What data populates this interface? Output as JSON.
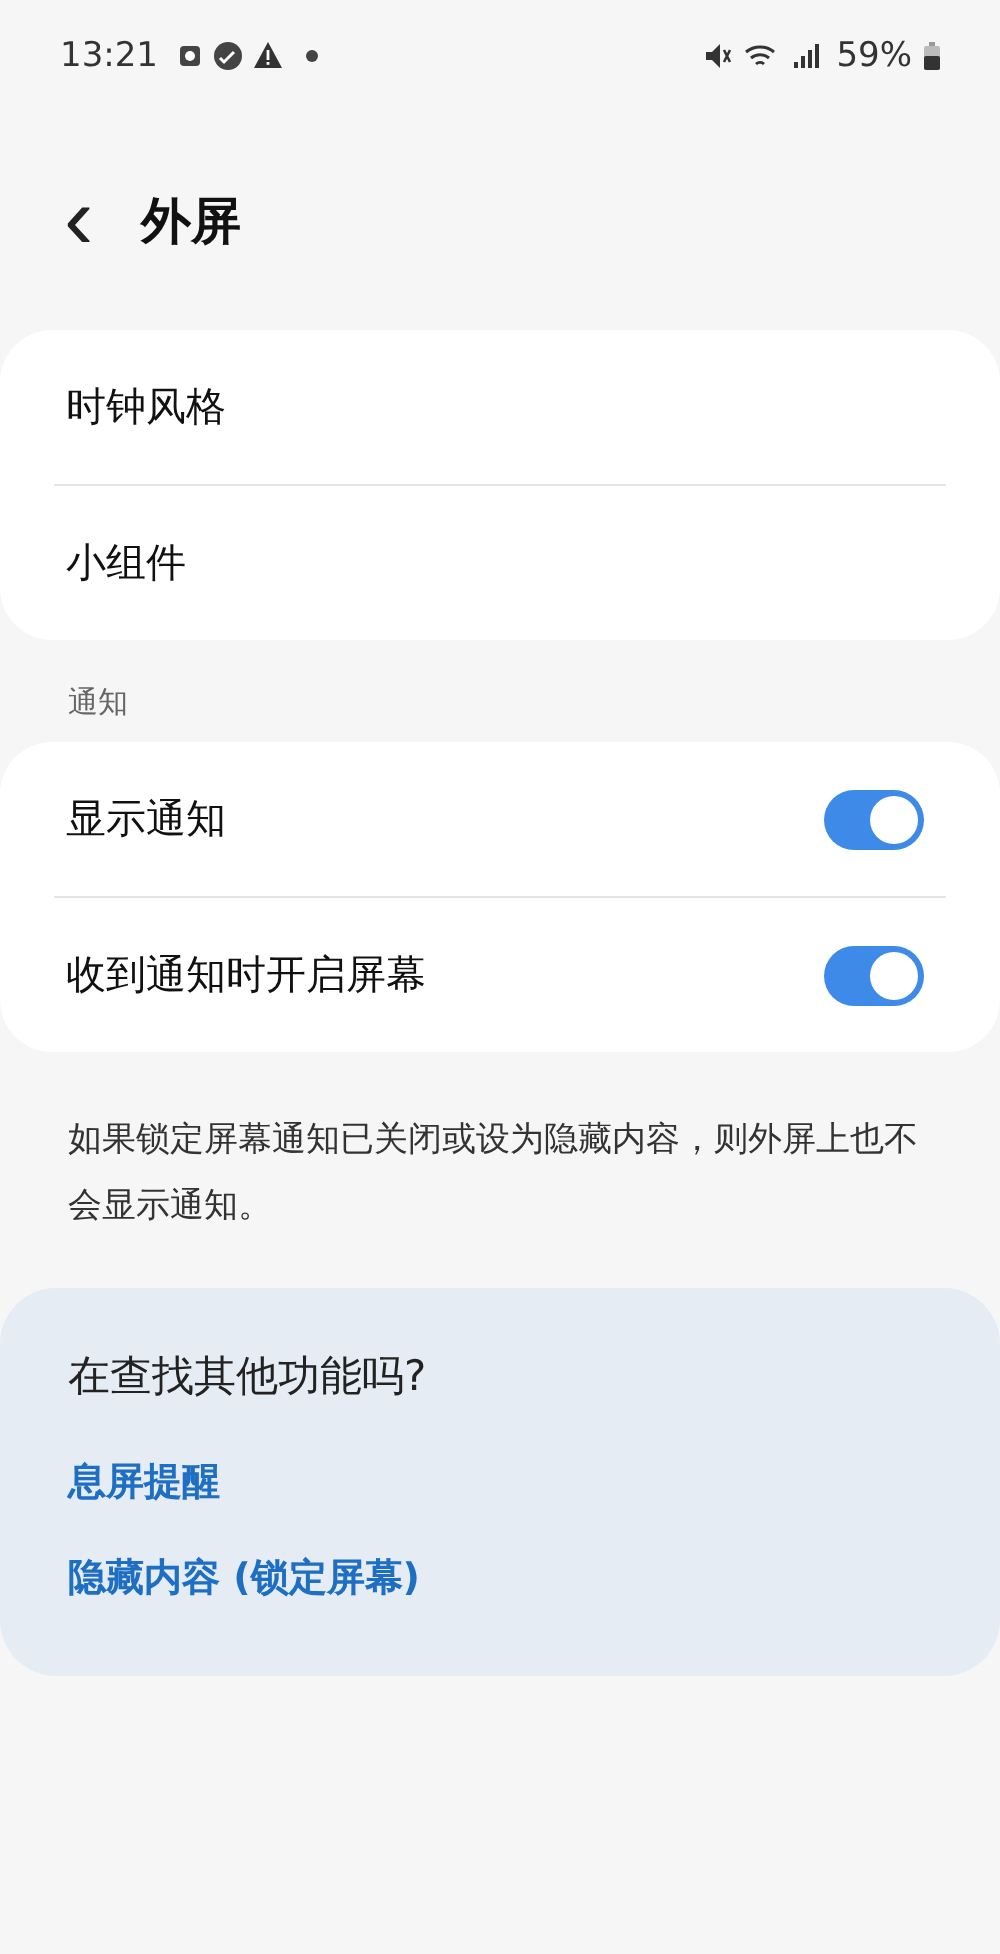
{
  "status_bar": {
    "time": "13:21",
    "battery": "59%"
  },
  "header": {
    "back": "‹",
    "title": "外屏"
  },
  "menu": [
    {
      "label": "时钟风格"
    },
    {
      "label": "小组件"
    }
  ],
  "notifications": {
    "heading": "通知",
    "items": [
      {
        "label": "显示通知",
        "on": true
      },
      {
        "label": "收到通知时开启屏幕",
        "on": true
      }
    ],
    "note": "如果锁定屏幕通知已关闭或设为隐藏内容，则外屏上也不会显示通知。"
  },
  "suggestions": {
    "title": "在查找其他功能吗?",
    "links": [
      "息屏提醒",
      "隐藏内容 (锁定屏幕)"
    ]
  }
}
